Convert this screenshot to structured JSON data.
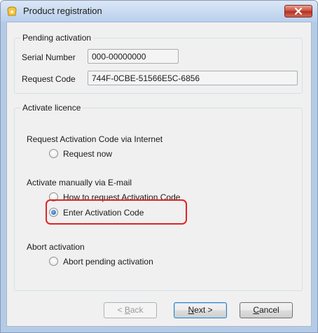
{
  "window": {
    "title": "Product registration"
  },
  "pending": {
    "legend": "Pending activation",
    "serial_label": "Serial Number",
    "serial_value": "000-00000000",
    "request_label": "Request Code",
    "request_value": "744F-0CBE-51566E5C-6856"
  },
  "activate": {
    "legend": "Activate licence",
    "internet_heading": "Request Activation Code via Internet",
    "request_now": "Request now",
    "email_heading": "Activate manually via E-mail",
    "how_to_request": "How to request Activation Code",
    "enter_code": "Enter Activation Code",
    "abort_heading": "Abort activation",
    "abort_pending": "Abort pending activation",
    "selected_option": "Enter Activation Code"
  },
  "buttons": {
    "back_accel": "B",
    "back_rest": "ack",
    "back_prefix": "< ",
    "next_accel": "N",
    "next_rest": "ext >",
    "cancel_accel": "C",
    "cancel_rest": "ancel"
  },
  "colors": {
    "highlight": "#e02424",
    "radio_selected": "#1f5fae"
  }
}
